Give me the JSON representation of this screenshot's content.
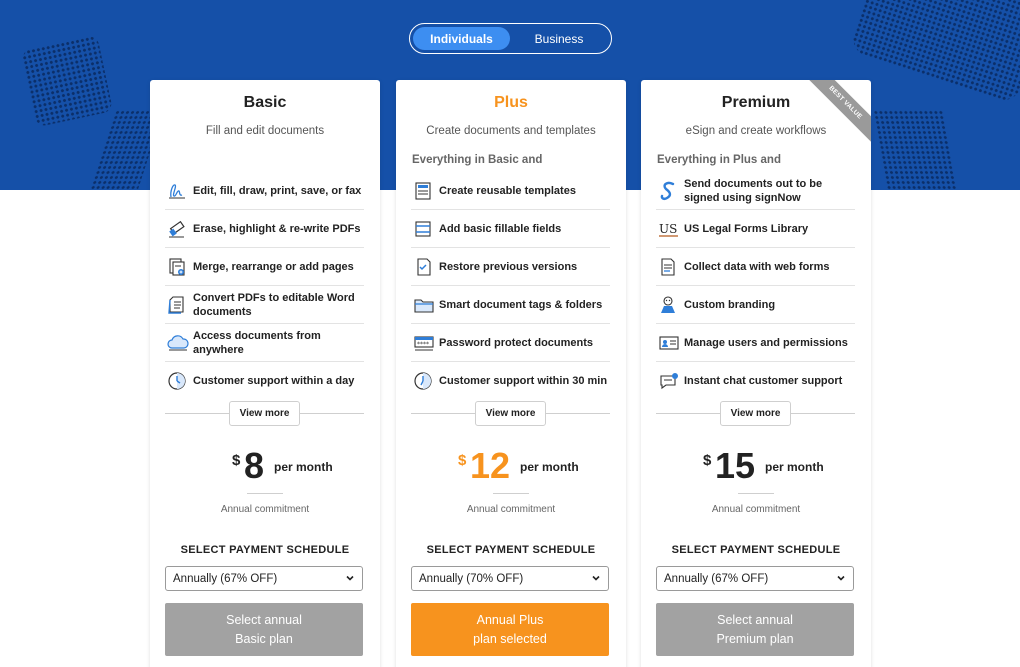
{
  "toggle": {
    "individuals": "Individuals",
    "business": "Business"
  },
  "plans": [
    {
      "name": "Basic",
      "subtitle": "Fill and edit documents",
      "everything": "",
      "features": [
        {
          "icon": "pen-sign-icon",
          "text": "Edit, fill, draw, print, save, or fax"
        },
        {
          "icon": "eraser-icon",
          "text": "Erase, highlight & re-write PDFs"
        },
        {
          "icon": "merge-pages-icon",
          "text": "Merge, rearrange or add pages"
        },
        {
          "icon": "convert-word-icon",
          "text": "Convert PDFs to editable Word documents"
        },
        {
          "icon": "cloud-icon",
          "text": "Access documents from anywhere"
        },
        {
          "icon": "clock-icon",
          "text": "Customer support within a day"
        }
      ],
      "view_more": "View more",
      "currency": "$",
      "price": "8",
      "per": "per month",
      "commitment": "Annual commitment",
      "schedule_label": "SELECT PAYMENT SCHEDULE",
      "schedule_value": "Annually (67% OFF)",
      "cta_line1": "Select annual",
      "cta_line2": "Basic plan"
    },
    {
      "name": "Plus",
      "subtitle": "Create documents and templates",
      "everything": "Everything in Basic and",
      "features": [
        {
          "icon": "template-icon",
          "text": "Create reusable templates"
        },
        {
          "icon": "fillable-fields-icon",
          "text": "Add basic fillable fields"
        },
        {
          "icon": "restore-versions-icon",
          "text": "Restore previous versions"
        },
        {
          "icon": "folder-icon",
          "text": "Smart document tags & folders"
        },
        {
          "icon": "password-icon",
          "text": "Password protect documents"
        },
        {
          "icon": "clock-icon",
          "text": "Customer support within 30 min"
        }
      ],
      "view_more": "View more",
      "currency": "$",
      "price": "12",
      "per": "per month",
      "commitment": "Annual commitment",
      "schedule_label": "SELECT PAYMENT SCHEDULE",
      "schedule_value": "Annually (70% OFF)",
      "cta_line1": "Annual Plus",
      "cta_line2": "plan selected"
    },
    {
      "name": "Premium",
      "subtitle": "eSign and create workflows",
      "everything": "Everything in Plus and",
      "ribbon": "BEST VALUE",
      "features": [
        {
          "icon": "signnow-icon",
          "text": "Send documents out to be signed using signNow"
        },
        {
          "icon": "us-legal-forms-icon",
          "text": "US Legal Forms Library"
        },
        {
          "icon": "web-form-icon",
          "text": "Collect data with web forms"
        },
        {
          "icon": "branding-icon",
          "text": "Custom branding"
        },
        {
          "icon": "users-permissions-icon",
          "text": "Manage users and permissions"
        },
        {
          "icon": "chat-icon",
          "text": "Instant chat customer support"
        }
      ],
      "view_more": "View more",
      "currency": "$",
      "price": "15",
      "per": "per month",
      "commitment": "Annual commitment",
      "schedule_label": "SELECT PAYMENT SCHEDULE",
      "schedule_value": "Annually (67% OFF)",
      "cta_line1": "Select annual",
      "cta_line2": "Premium plan"
    }
  ],
  "colors": {
    "hero": "#1550a8",
    "toggle_active": "#3d8ef1",
    "accent_orange": "#f7931e",
    "cta_gray": "#a2a2a2",
    "icon_blue": "#2f7ed8"
  }
}
